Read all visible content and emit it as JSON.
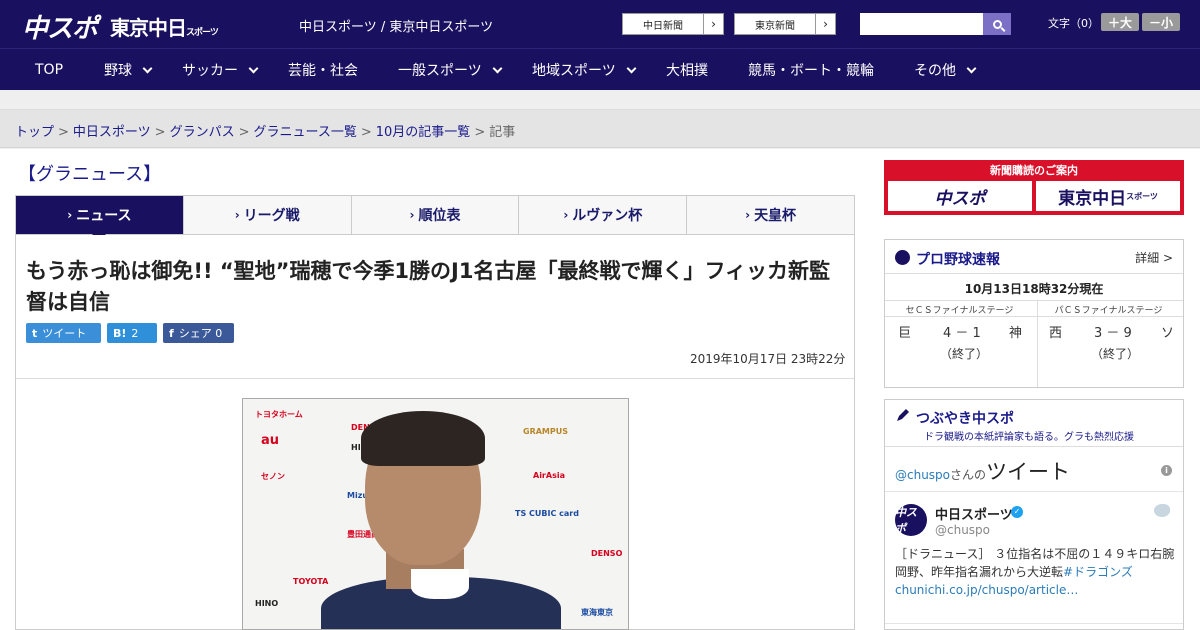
{
  "header": {
    "logo_main": "中スポ",
    "logo_tokyo": "東京中日",
    "logo_tokyo_small": "スポーツ",
    "site_names": "中日スポーツ / 東京中日スポーツ",
    "ext_links": [
      {
        "label": "中日新聞",
        "arrow": "›"
      },
      {
        "label": "東京新聞",
        "arrow": "›"
      }
    ],
    "search": {
      "value": "",
      "placeholder": ""
    },
    "fontsize_label": "文字（0）",
    "fontsize_plus": "＋大",
    "fontsize_minus": "－小"
  },
  "nav": {
    "items": [
      {
        "label": "TOP",
        "dropdown": false
      },
      {
        "label": "野球",
        "dropdown": true
      },
      {
        "label": "サッカー",
        "dropdown": true
      },
      {
        "label": "芸能・社会",
        "dropdown": false
      },
      {
        "label": "一般スポーツ",
        "dropdown": true
      },
      {
        "label": "地域スポーツ",
        "dropdown": true
      },
      {
        "label": "大相撲",
        "dropdown": false
      },
      {
        "label": "競馬・ボート・競輪",
        "dropdown": false
      },
      {
        "label": "その他",
        "dropdown": true
      }
    ]
  },
  "breadcrumb": {
    "items": [
      "トップ",
      "中日スポーツ",
      "グランパス",
      "グラニュース一覧",
      "10月の記事一覧"
    ],
    "current": "記事",
    "separator": ">"
  },
  "section_title": "【グラニュース】",
  "tabs": [
    {
      "label": "ニュース",
      "active": true
    },
    {
      "label": "リーグ戦",
      "active": false
    },
    {
      "label": "順位表",
      "active": false
    },
    {
      "label": "ルヴァン杯",
      "active": false
    },
    {
      "label": "天皇杯",
      "active": false
    }
  ],
  "tab_marker": "›",
  "article": {
    "headline": "もう赤っ恥は御免!! “聖地”瑞穂で今季1勝のJ1名古屋「最終戦で輝く」フィッカ新監督は自信",
    "share": {
      "tweet_icon": "t",
      "tweet_label": "ツイート",
      "hatena_icon": "B!",
      "hatena_count": "2",
      "fb_icon": "f",
      "fb_label": "シェア",
      "fb_count": "0"
    },
    "date": "2019年10月17日 23時22分",
    "photo_sponsor_labels": [
      "トヨタホーム",
      "DENSO",
      "HINO",
      "GRAMPUS",
      "au",
      "AirAsia",
      "セノン",
      "TOYOTA",
      "Mizuno",
      "豊田通商",
      "TS CUBIC card",
      "東海東京",
      "DENSO",
      "HINO"
    ]
  },
  "sidebar": {
    "subscription": {
      "title": "新聞購読のご案内",
      "btn1": "中スポ",
      "btn2": "東京中日",
      "btn2_small": "スポーツ"
    },
    "baseball": {
      "title": "プロ野球速報",
      "detail": "詳細 >",
      "time": "10月13日18時32分現在",
      "games": [
        {
          "stage": "セＣＳファイナルステージ",
          "home": "巨",
          "score": "4 － 1",
          "away": "神",
          "status": "（終了）"
        },
        {
          "stage": "パＣＳファイナルステージ",
          "home": "西",
          "score": "3 － 9",
          "away": "ソ",
          "status": "（終了）"
        }
      ]
    },
    "twitter": {
      "title": "つぶやき中スポ",
      "subtitle": "ドラ観戦の本紙評論家も語る。グラも熱烈応援",
      "handle_link": "@chuspo",
      "san": "さんの",
      "tweet_word": "ツイート",
      "info": "i",
      "avatar_text": "中スポ",
      "user_name": "中日スポーツ",
      "verified_mark": "✓",
      "user_handle": "@chuspo",
      "tweet_text": "［ドラニュース］ ３位指名は不屈の１４９キロ右腕　岡野、昨年指名漏れから大逆転",
      "tweet_tag": "#ドラゴンズ",
      "tweet_link": "chunichi.co.jp/chuspo/article…"
    }
  },
  "colors": {
    "brand": "#1a1060",
    "accent_red": "#d8102a",
    "link": "#1a1a8a"
  }
}
